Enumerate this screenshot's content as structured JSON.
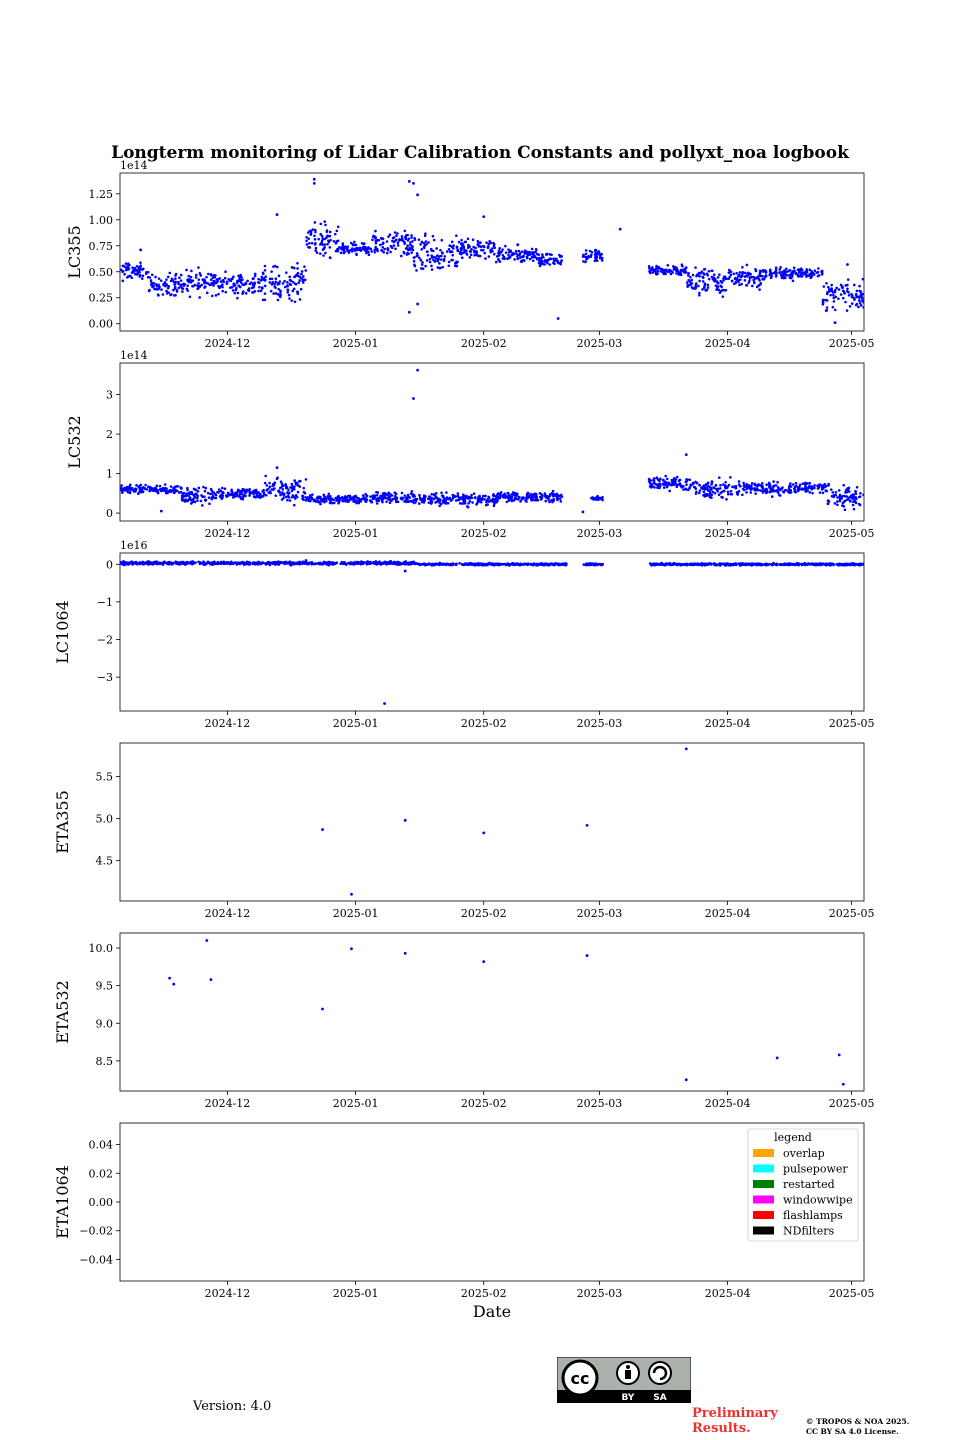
{
  "chart_data": {
    "type": "scatter",
    "title": "Longterm monitoring of Lidar Calibration Constants and pollyxt_noa logbook",
    "x_range": [
      "2024-11-05",
      "2025-05-04"
    ],
    "x_ticks": [
      "2024-12",
      "2025-01",
      "2025-02",
      "2025-03",
      "2025-04",
      "2025-05"
    ],
    "xlabel": "Date",
    "marker_color": "#0000ff",
    "panels": [
      {
        "ylabel": "LC355",
        "offset_text": "1e14",
        "ylim": [
          -0.07,
          1.45
        ],
        "yticks": [
          0.0,
          0.25,
          0.5,
          0.75,
          1.0,
          1.25
        ],
        "ytick_labels": [
          "0.00",
          "0.25",
          "0.50",
          "0.75",
          "1.00",
          "1.25"
        ],
        "segments": [
          {
            "from": "2024-11-05",
            "to": "2024-11-12",
            "center": 0.5,
            "spread": 0.06
          },
          {
            "from": "2024-11-12",
            "to": "2024-11-20",
            "center": 0.38,
            "spread": 0.08
          },
          {
            "from": "2024-11-20",
            "to": "2024-11-28",
            "center": 0.4,
            "spread": 0.09
          },
          {
            "from": "2024-11-28",
            "to": "2024-12-08",
            "center": 0.38,
            "spread": 0.08
          },
          {
            "from": "2024-12-08",
            "to": "2024-12-20",
            "center": 0.4,
            "spread": 0.12
          },
          {
            "from": "2024-12-20",
            "to": "2024-12-28",
            "center": 0.8,
            "spread": 0.12
          },
          {
            "from": "2024-12-28",
            "to": "2025-01-05",
            "center": 0.72,
            "spread": 0.04
          },
          {
            "from": "2025-01-05",
            "to": "2025-01-15",
            "center": 0.76,
            "spread": 0.09
          },
          {
            "from": "2025-01-15",
            "to": "2025-01-26",
            "center": 0.65,
            "spread": 0.15
          },
          {
            "from": "2025-01-26",
            "to": "2025-02-04",
            "center": 0.72,
            "spread": 0.07
          },
          {
            "from": "2025-02-04",
            "to": "2025-02-14",
            "center": 0.66,
            "spread": 0.06
          },
          {
            "from": "2025-02-14",
            "to": "2025-02-20",
            "center": 0.62,
            "spread": 0.05
          },
          {
            "from": "2025-02-25",
            "to": "2025-03-02",
            "center": 0.65,
            "spread": 0.04
          },
          {
            "from": "2025-03-13",
            "to": "2025-03-22",
            "center": 0.52,
            "spread": 0.04
          },
          {
            "from": "2025-03-22",
            "to": "2025-04-01",
            "center": 0.4,
            "spread": 0.1
          },
          {
            "from": "2025-04-01",
            "to": "2025-04-10",
            "center": 0.45,
            "spread": 0.08
          },
          {
            "from": "2025-04-10",
            "to": "2025-04-18",
            "center": 0.48,
            "spread": 0.04
          },
          {
            "from": "2025-04-18",
            "to": "2025-04-24",
            "center": 0.49,
            "spread": 0.04
          },
          {
            "from": "2025-04-24",
            "to": "2025-05-04",
            "center": 0.27,
            "spread": 0.1
          }
        ],
        "outliers": [
          {
            "x": "2024-12-22",
            "y": 1.35
          },
          {
            "x": "2024-12-22",
            "y": 1.39
          },
          {
            "x": "2025-01-14",
            "y": 1.37
          },
          {
            "x": "2025-01-15",
            "y": 1.35
          },
          {
            "x": "2025-01-16",
            "y": 1.24
          },
          {
            "x": "2025-02-01",
            "y": 1.03
          },
          {
            "x": "2025-01-14",
            "y": 0.11
          },
          {
            "x": "2025-01-16",
            "y": 0.19
          },
          {
            "x": "2025-02-19",
            "y": 0.05
          },
          {
            "x": "2025-03-06",
            "y": 0.91
          },
          {
            "x": "2024-11-10",
            "y": 0.71
          },
          {
            "x": "2024-12-13",
            "y": 1.05
          },
          {
            "x": "2025-04-27",
            "y": 0.01
          },
          {
            "x": "2025-04-30",
            "y": 0.57
          }
        ]
      },
      {
        "ylabel": "LC532",
        "offset_text": "1e14",
        "ylim": [
          -0.2,
          3.8
        ],
        "yticks": [
          0,
          1,
          2,
          3
        ],
        "ytick_labels": [
          "0",
          "1",
          "2",
          "3"
        ],
        "segments": [
          {
            "from": "2024-11-05",
            "to": "2024-11-20",
            "center": 0.6,
            "spread": 0.08
          },
          {
            "from": "2024-11-20",
            "to": "2024-11-28",
            "center": 0.45,
            "spread": 0.15
          },
          {
            "from": "2024-11-28",
            "to": "2024-12-10",
            "center": 0.5,
            "spread": 0.1
          },
          {
            "from": "2024-12-10",
            "to": "2024-12-20",
            "center": 0.55,
            "spread": 0.25
          },
          {
            "from": "2024-12-20",
            "to": "2025-01-05",
            "center": 0.35,
            "spread": 0.08
          },
          {
            "from": "2025-01-05",
            "to": "2025-01-15",
            "center": 0.4,
            "spread": 0.1
          },
          {
            "from": "2025-01-15",
            "to": "2025-02-04",
            "center": 0.35,
            "spread": 0.12
          },
          {
            "from": "2025-02-04",
            "to": "2025-02-20",
            "center": 0.4,
            "spread": 0.1
          },
          {
            "from": "2025-02-27",
            "to": "2025-03-02",
            "center": 0.38,
            "spread": 0.04
          },
          {
            "from": "2025-03-13",
            "to": "2025-03-24",
            "center": 0.75,
            "spread": 0.12
          },
          {
            "from": "2025-03-24",
            "to": "2025-04-05",
            "center": 0.6,
            "spread": 0.18
          },
          {
            "from": "2025-04-05",
            "to": "2025-04-18",
            "center": 0.62,
            "spread": 0.12
          },
          {
            "from": "2025-04-18",
            "to": "2025-04-25",
            "center": 0.65,
            "spread": 0.1
          },
          {
            "from": "2025-04-25",
            "to": "2025-05-04",
            "center": 0.4,
            "spread": 0.2
          }
        ],
        "outliers": [
          {
            "x": "2025-01-16",
            "y": 3.62
          },
          {
            "x": "2025-01-15",
            "y": 2.9
          },
          {
            "x": "2025-03-22",
            "y": 1.48
          },
          {
            "x": "2024-12-13",
            "y": 1.15
          },
          {
            "x": "2025-02-25",
            "y": 0.03
          },
          {
            "x": "2024-11-15",
            "y": 0.05
          }
        ]
      },
      {
        "ylabel": "LC1064",
        "offset_text": "1e16",
        "ylim": [
          -3.9,
          0.3
        ],
        "yticks": [
          0,
          -1,
          -2,
          -3
        ],
        "ytick_labels": [
          "0",
          "−1",
          "−2",
          "−3"
        ],
        "segments": [
          {
            "from": "2024-11-05",
            "to": "2025-01-16",
            "center": 0.03,
            "spread": 0.03
          },
          {
            "from": "2025-01-16",
            "to": "2025-02-21",
            "center": 0.0,
            "spread": 0.02
          },
          {
            "from": "2025-02-25",
            "to": "2025-03-02",
            "center": 0.0,
            "spread": 0.02
          },
          {
            "from": "2025-03-13",
            "to": "2025-05-04",
            "center": 0.0,
            "spread": 0.02
          }
        ],
        "outliers": [
          {
            "x": "2025-01-08",
            "y": -3.7
          },
          {
            "x": "2025-01-13",
            "y": -0.18
          },
          {
            "x": "2024-12-20",
            "y": 0.1
          }
        ]
      },
      {
        "ylabel": "ETA355",
        "offset_text": "",
        "ylim": [
          4.02,
          5.9
        ],
        "yticks": [
          4.5,
          5.0,
          5.5
        ],
        "ytick_labels": [
          "4.5",
          "5.0",
          "5.5"
        ],
        "points": [
          {
            "x": "2024-12-24",
            "y": 4.87
          },
          {
            "x": "2024-12-31",
            "y": 4.1
          },
          {
            "x": "2025-01-13",
            "y": 4.98
          },
          {
            "x": "2025-02-01",
            "y": 4.83
          },
          {
            "x": "2025-02-26",
            "y": 4.92
          },
          {
            "x": "2025-03-22",
            "y": 5.83
          }
        ]
      },
      {
        "ylabel": "ETA532",
        "offset_text": "",
        "ylim": [
          8.1,
          10.2
        ],
        "yticks": [
          8.5,
          9.0,
          9.5,
          10.0
        ],
        "ytick_labels": [
          "8.5",
          "9.0",
          "9.5",
          "10.0"
        ],
        "points": [
          {
            "x": "2024-11-17",
            "y": 9.6
          },
          {
            "x": "2024-11-18",
            "y": 9.52
          },
          {
            "x": "2024-11-26",
            "y": 10.1
          },
          {
            "x": "2024-11-27",
            "y": 9.58
          },
          {
            "x": "2024-12-24",
            "y": 9.19
          },
          {
            "x": "2024-12-31",
            "y": 9.99
          },
          {
            "x": "2025-01-13",
            "y": 9.93
          },
          {
            "x": "2025-02-01",
            "y": 9.82
          },
          {
            "x": "2025-02-26",
            "y": 9.9
          },
          {
            "x": "2025-03-22",
            "y": 8.25
          },
          {
            "x": "2025-04-13",
            "y": 8.54
          },
          {
            "x": "2025-04-28",
            "y": 8.58
          },
          {
            "x": "2025-04-29",
            "y": 8.19
          }
        ]
      },
      {
        "ylabel": "ETA1064",
        "offset_text": "",
        "ylim": [
          -0.055,
          0.055
        ],
        "yticks": [
          0.04,
          0.02,
          0.0,
          -0.02,
          -0.04
        ],
        "ytick_labels": [
          "0.04",
          "0.02",
          "0.00",
          "−0.02",
          "−0.04"
        ],
        "points": []
      }
    ],
    "legend": {
      "title": "legend",
      "location": "upper right",
      "items": [
        {
          "label": "overlap",
          "color": "#ffa500"
        },
        {
          "label": "pulsepower",
          "color": "#00ffff"
        },
        {
          "label": "restarted",
          "color": "#008000"
        },
        {
          "label": "windowwipe",
          "color": "#ff00ff"
        },
        {
          "label": "flashlamps",
          "color": "#ff0000"
        },
        {
          "label": "NDfilters",
          "color": "#000000"
        }
      ]
    }
  },
  "footer": {
    "version": "Version: 4.0",
    "preliminary_line1": "Preliminary",
    "preliminary_line2": "Results.",
    "copyright_line1": "© TROPOS & NOA 2025.",
    "copyright_line2": "CC BY SA 4.0 License.",
    "cc_by": "BY",
    "cc_sa": "SA"
  }
}
